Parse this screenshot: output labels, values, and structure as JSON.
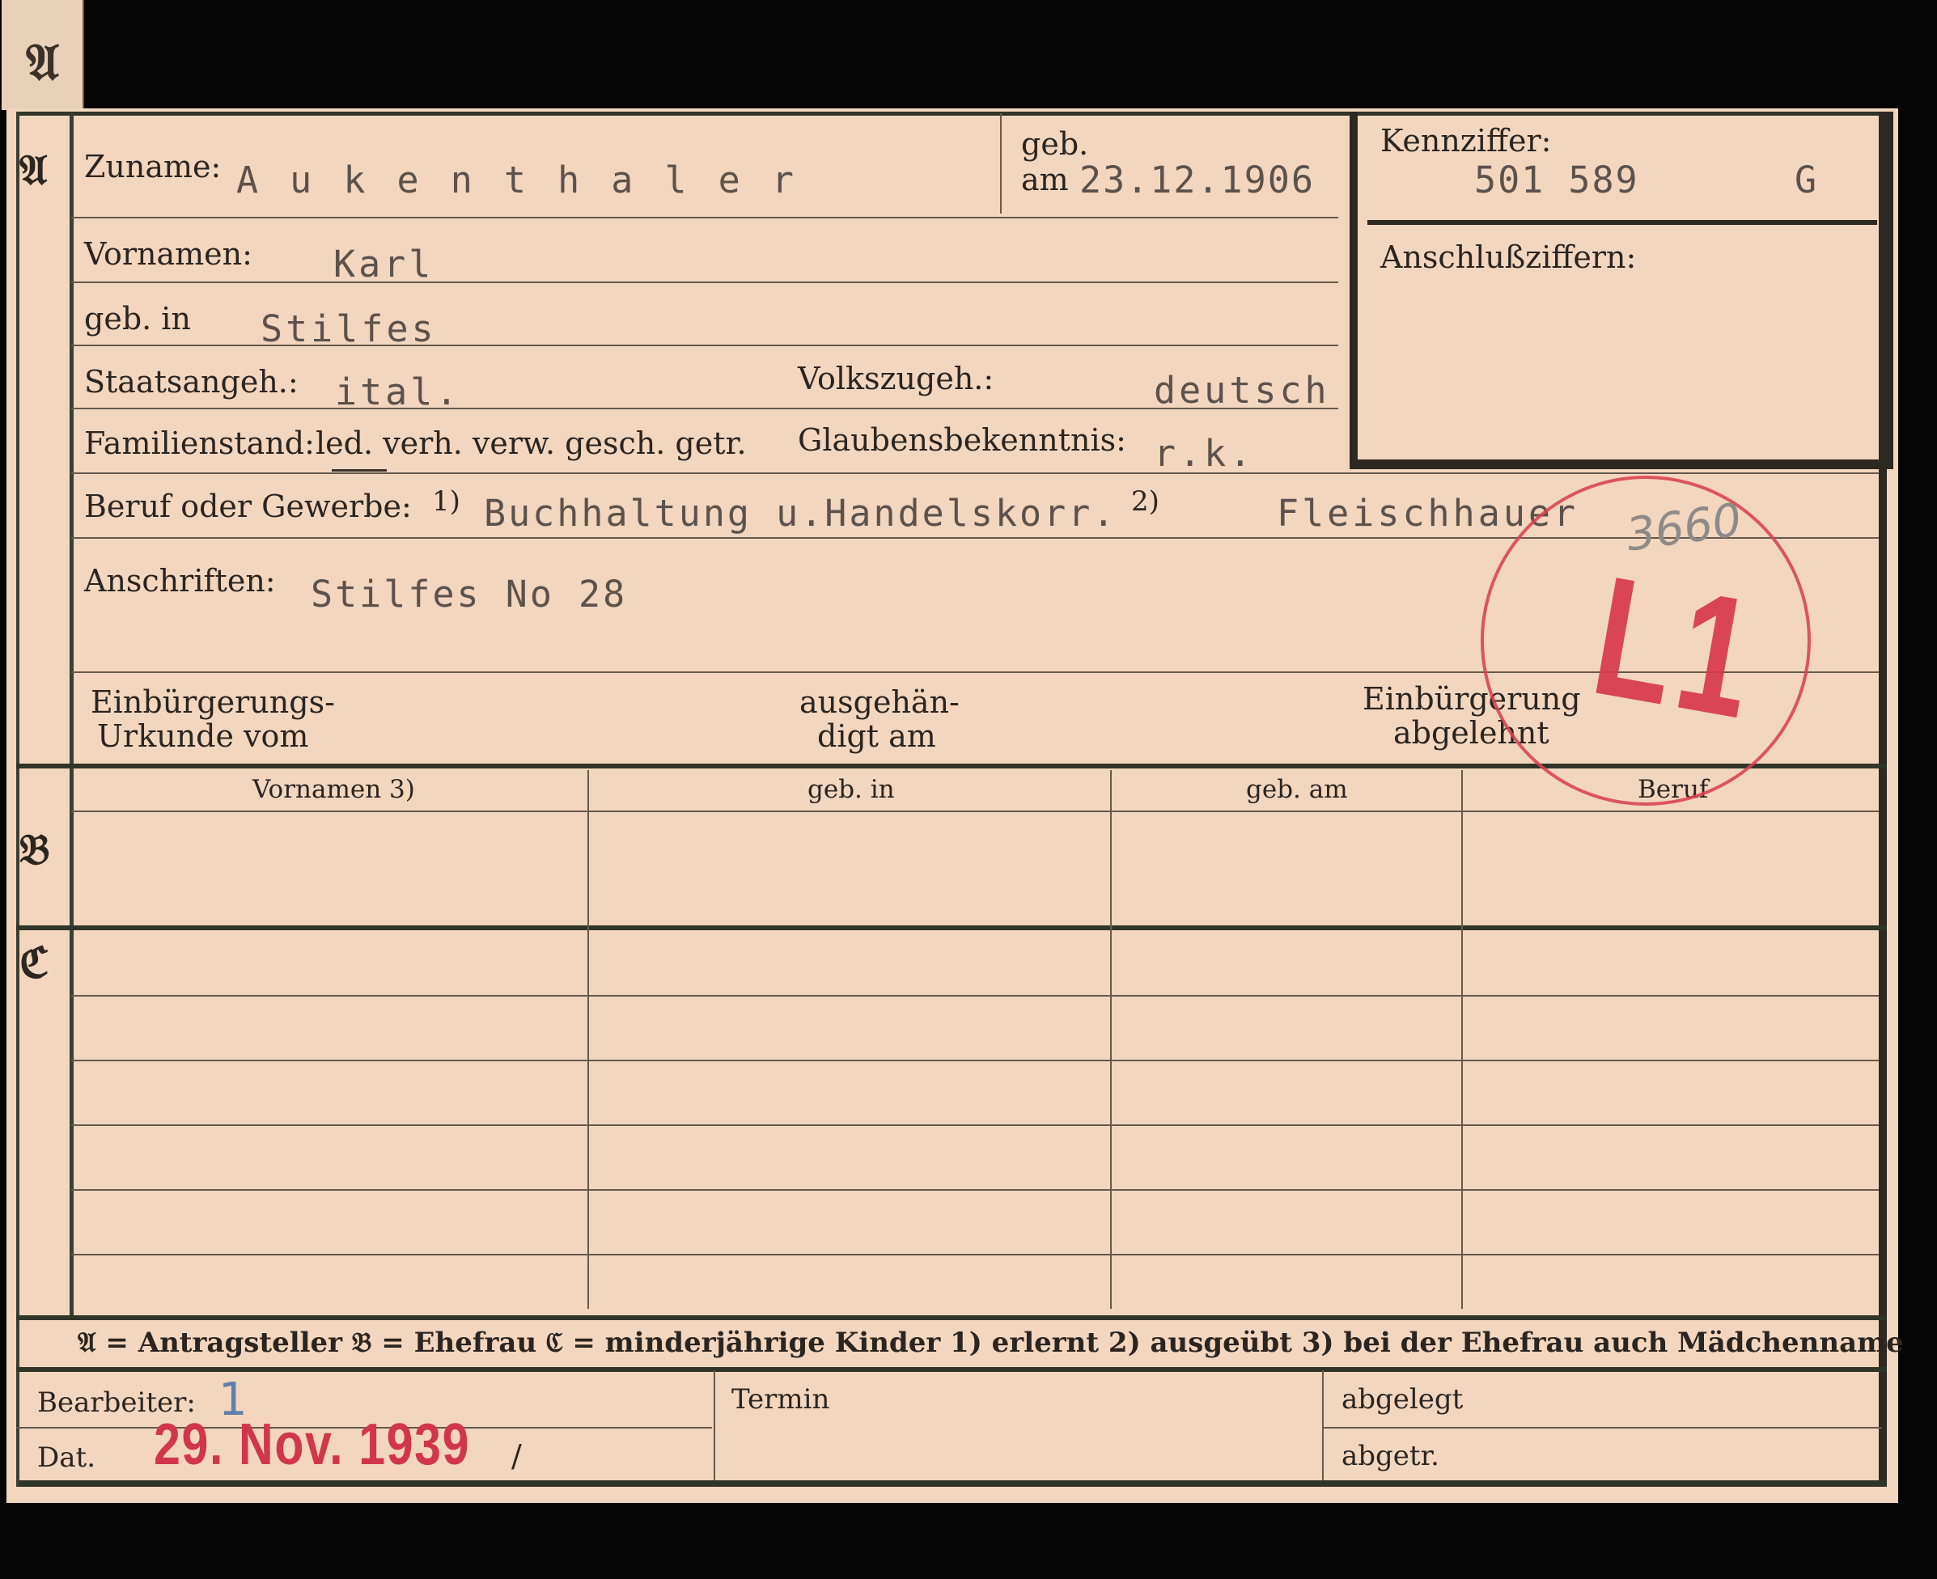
{
  "tab": {
    "letter": "𝔄"
  },
  "section_letters": {
    "a": "𝔄",
    "b": "𝔅",
    "c": "ℭ"
  },
  "a": {
    "zuname_label": "Zuname:",
    "zuname": "A u k e n t h a l e r",
    "geb_label": "geb.",
    "am_label": "am",
    "geb_am": "23.12.1906",
    "kennziffer_label": "Kennziffer:",
    "kennziffer": "501 589",
    "kennziffer_suffix": "G",
    "anschluss_label": "Anschlußziffern:",
    "vornamen_label": "Vornamen:",
    "vornamen": "Karl",
    "geb_in_label": "geb. in",
    "geb_in": "Stilfes",
    "staats_label": "Staatsangeh.:",
    "staats": "ital.",
    "volks_label": "Volkszugeh.:",
    "volks": "deutsch",
    "familien_label": "Familienstand:",
    "familien_options": "led. verh. verw. gesch. getr.",
    "glaubens_label": "Glaubensbekenntnis:",
    "glaubens": "r.k.",
    "beruf_label": "Beruf oder Gewerbe:",
    "beruf_mark1": "1)",
    "beruf1": "Buchhaltung u.Handelskorr.",
    "beruf_mark2": "2)",
    "beruf2": "Fleischhauer",
    "anschriften_label": "Anschriften:",
    "anschrift": "Stilfes No 28",
    "einbuerg_label_1": "Einbürgerungs-",
    "einbuerg_label_2": "Urkunde vom",
    "ausgeh_label_1": "ausgehän-",
    "ausgeh_label_2": "digt am",
    "abgelehnt_label_1": "Einbürgerung",
    "abgelehnt_label_2": "abgelehnt"
  },
  "table": {
    "headers": [
      "Vornamen 3)",
      "geb. in",
      "geb. am",
      "Beruf"
    ]
  },
  "legend": "𝔄 = Antragsteller   𝔅 = Ehefrau   ℭ = minderjährige Kinder   1) erlernt   2) ausgeübt   3) bei der Ehefrau auch Mädchenname",
  "footer": {
    "bearbeiter_label": "Bearbeiter:",
    "bearbeiter_mark": "1",
    "dat_label": "Dat.",
    "date": "29. Nov. 1939",
    "slash": "/",
    "termin_label": "Termin",
    "abgelegt_label": "abgelegt",
    "abgetr_label": "abgetr."
  },
  "stamp": {
    "text": "L1",
    "note": "3660"
  },
  "colors": {
    "card": "#f2d6be",
    "ink_red": "#d1364a",
    "frame": "#2c2822"
  }
}
